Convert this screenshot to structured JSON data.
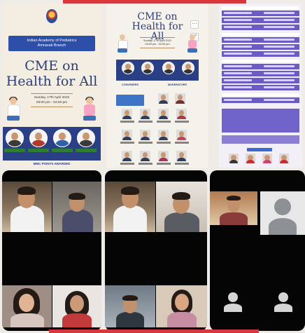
{
  "poster1": {
    "org_line1": "Indian Academy of Pediatrics",
    "org_line2": "Amravati Branch",
    "title_line1": "CME on",
    "title_line2": "Health for All",
    "date_line1": "Sunday, 17th April 2022",
    "date_line2": "03:00 pm - 04:00 pm",
    "footer": "MMC POINTS AWARDED"
  },
  "poster2": {
    "title_line1": "CME on",
    "title_line2": "Health for All",
    "date_line1": "Sunday, 17th April 2022",
    "date_line2": "03:00 pm - 04:00 pm",
    "tag_left": "CONVENERS",
    "tag_right": "MODERATORS"
  },
  "colors": {
    "poster_navy": "#2b3f86",
    "accent_red": "#d8373e",
    "schedule_purple": "#6a5cc4"
  }
}
